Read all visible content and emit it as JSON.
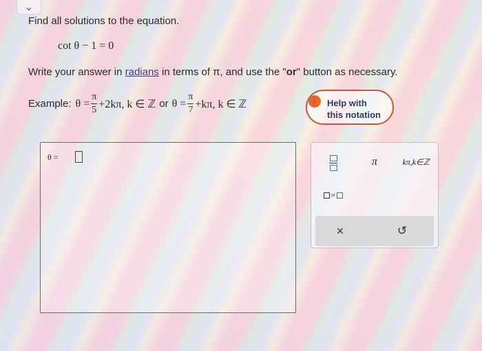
{
  "collapse_icon": "chevron-down-icon",
  "problem": {
    "prompt": "Find all solutions to the equation.",
    "equation": "cot θ − 1 = 0",
    "instructions": {
      "before": "Write your answer in ",
      "link": "radians",
      "middle": " in terms of π, and use the \"",
      "bold": "or",
      "after": "\" button as necessary."
    },
    "example": {
      "label": "Example:",
      "t1_prefix": "θ =",
      "t1_num": "π",
      "t1_den": "5",
      "t1_suffix": "+2kπ, k ∈ ℤ",
      "or": "or",
      "t2_prefix": "θ =",
      "t2_num": "π",
      "t2_den": "7",
      "t2_suffix": "+kπ, k ∈ ℤ"
    }
  },
  "help": {
    "icon": "lightbulb-icon",
    "line1": "Help with",
    "line2": "this notation"
  },
  "answer": {
    "lhs": "θ ="
  },
  "keypad": {
    "fraction_icon": "fraction-icon",
    "pi": "π",
    "kpi": "kπ,k∈ℤ",
    "or_label": "or",
    "clear": "×",
    "undo": "↺"
  }
}
